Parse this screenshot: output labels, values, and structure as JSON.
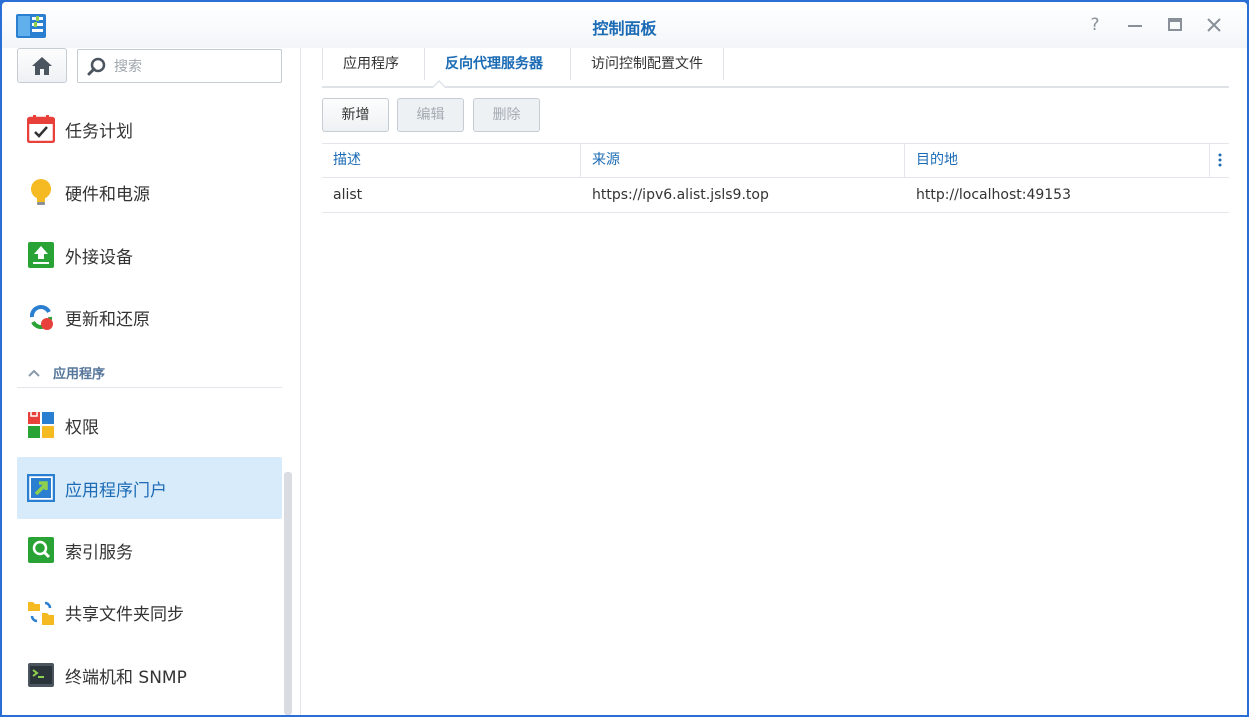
{
  "window": {
    "title": "控制面板"
  },
  "sidebar": {
    "search_placeholder": "搜索",
    "items_top": [
      {
        "label": "任务计划"
      },
      {
        "label": "硬件和电源"
      },
      {
        "label": "外接设备"
      },
      {
        "label": "更新和还原"
      }
    ],
    "section": {
      "label": "应用程序"
    },
    "items_apps": [
      {
        "label": "权限"
      },
      {
        "label": "应用程序门户"
      },
      {
        "label": "索引服务"
      },
      {
        "label": "共享文件夹同步"
      },
      {
        "label": "终端机和 SNMP"
      }
    ]
  },
  "main": {
    "tabs": [
      {
        "label": "应用程序"
      },
      {
        "label": "反向代理服务器"
      },
      {
        "label": "访问控制配置文件"
      }
    ],
    "toolbar": {
      "add": "新增",
      "edit": "编辑",
      "delete": "删除"
    },
    "table": {
      "columns": [
        "描述",
        "来源",
        "目的地"
      ],
      "rows": [
        [
          "alist",
          "https://ipv6.alist.jsls9.top",
          "http://localhost:49153"
        ]
      ]
    }
  },
  "colors": {
    "accent": "#1c6bb5",
    "active_bg": "#d8ebfa",
    "frame": "#2a6fd6"
  }
}
